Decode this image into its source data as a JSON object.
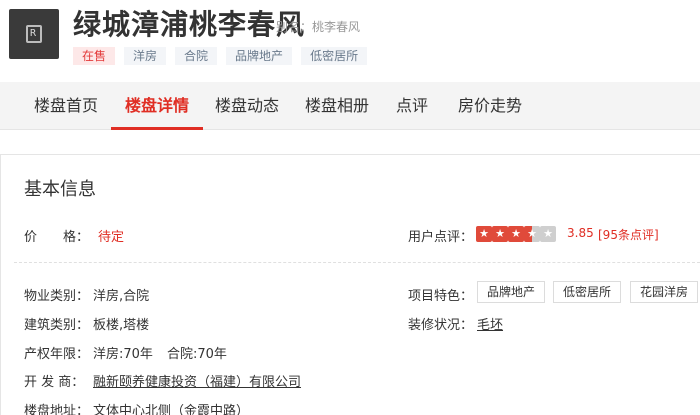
{
  "header": {
    "logo_text": "R",
    "title": "绿城漳浦桃李春风",
    "alias": "别名：桃李春风",
    "tags": [
      "在售",
      "洋房",
      "合院",
      "品牌地产",
      "低密居所"
    ]
  },
  "nav": {
    "items": [
      "楼盘首页",
      "楼盘详情",
      "楼盘动态",
      "楼盘相册",
      "点评",
      "房价走势"
    ],
    "active": "楼盘详情"
  },
  "info": {
    "section_title": "基本信息",
    "price_label": "价　　格：",
    "price_value": "待定",
    "rating_label": "用户点评：",
    "rating": 3.85,
    "rating_text": "3.85",
    "reviews": "[95条点评]",
    "property_type_label": "物业类别：",
    "property_type_value": "洋房,合院",
    "building_type_label": "建筑类别：",
    "building_type_value": "板楼,塔楼",
    "tenure_label": "产权年限：",
    "tenure_value_1": "洋房:70年",
    "tenure_value_2": "合院:70年",
    "developer_label": "开  发  商：",
    "developer_value": "融新颐养健康投资（福建）有限公司",
    "address_label": "楼盘地址：",
    "address_value": "文体中心北侧（金霞中路）",
    "features_label": "项目特色：",
    "features": [
      "品牌地产",
      "低密居所",
      "花园洋房"
    ],
    "decoration_label": "装修状况：",
    "decoration_value": "毛坯"
  },
  "colors": {
    "accent": "#e02e24",
    "nav_bg": "#f4f4f4",
    "star_full": "#e04a3a",
    "star_empty": "#cfcfcf"
  }
}
